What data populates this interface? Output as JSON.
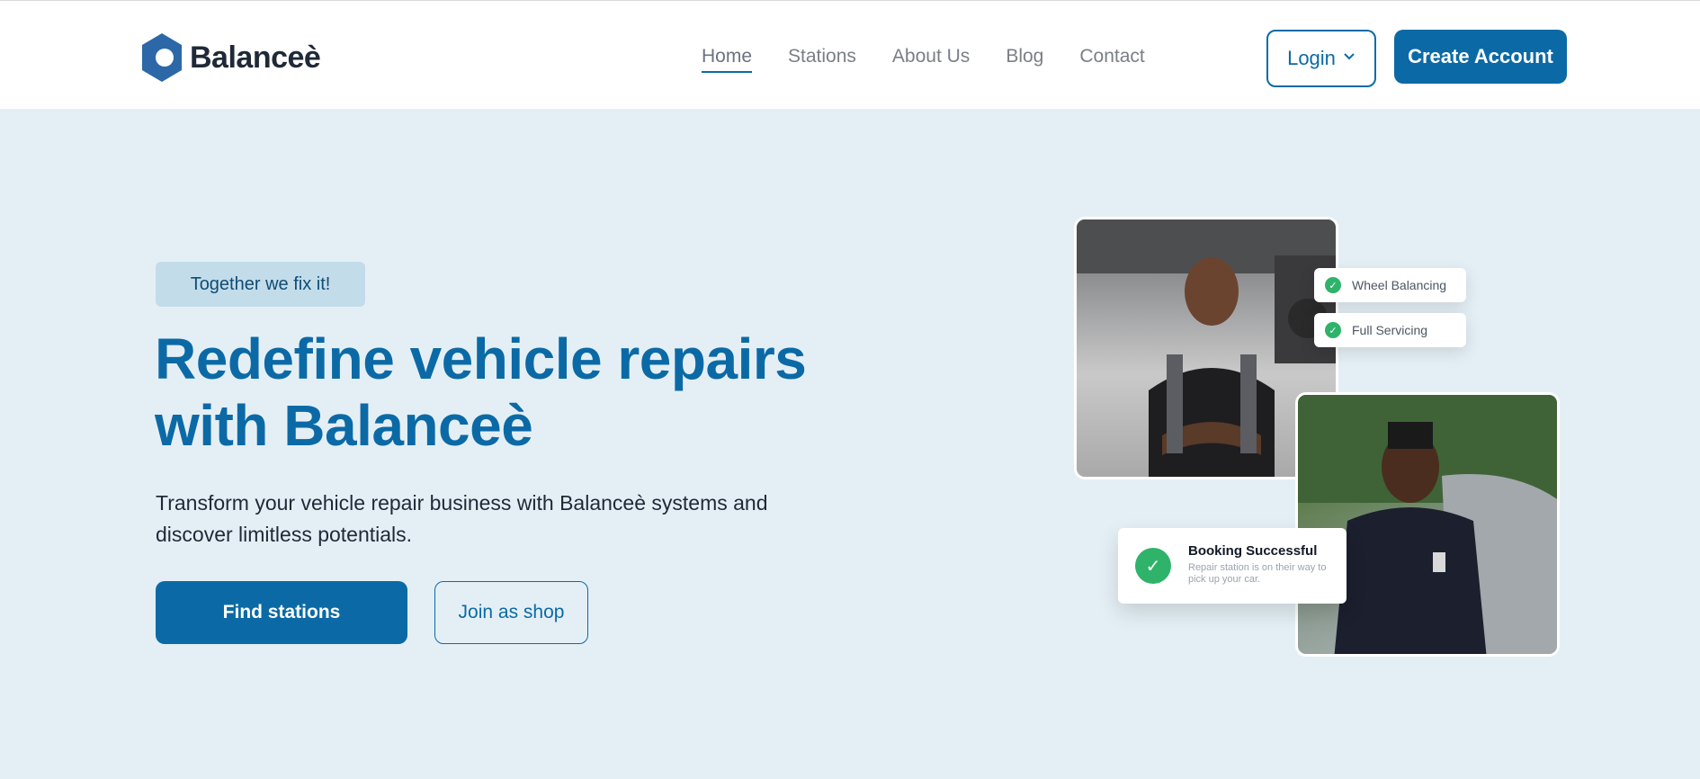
{
  "brand": {
    "name": "Balanceè",
    "accent": "#0b6aa6"
  },
  "nav": {
    "links": [
      {
        "label": "Home",
        "active": true
      },
      {
        "label": "Stations"
      },
      {
        "label": "About Us"
      },
      {
        "label": "Blog"
      },
      {
        "label": "Contact"
      }
    ],
    "login_label": "Login",
    "create_label": "Create Account"
  },
  "hero": {
    "tag": "Together we fix it!",
    "title": "Redefine vehicle repairs with Balanceè",
    "subtitle": "Transform your vehicle repair business with Balanceè systems and discover limitless potentials.",
    "primary_cta": "Find stations",
    "secondary_cta": "Join as shop"
  },
  "cards": {
    "chips": [
      "Wheel Balancing",
      "Full Servicing"
    ],
    "booking_title": "Booking Successful",
    "booking_desc": "Repair station is on their way to pick up your car."
  },
  "icons": {
    "logo": "hexagon-logo-icon",
    "chevron": "chevron-down-icon",
    "check": "check-icon"
  }
}
